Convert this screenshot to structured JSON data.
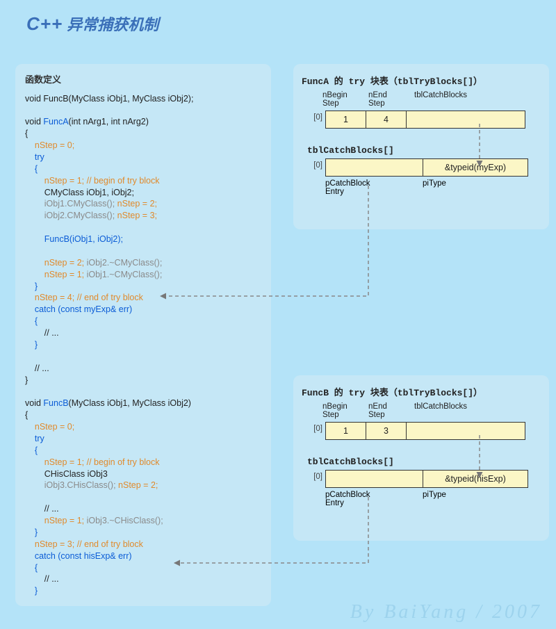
{
  "title": {
    "cpp": "C++",
    "rest": " 异常捕获机制"
  },
  "leftPanel": {
    "heading": "函数定义",
    "lines": [
      {
        "cls": "c-black",
        "text": "void FuncB(MyClass iObj1, MyClass iObj2);"
      },
      {
        "cls": "",
        "text": " "
      },
      {
        "cls": "c-black",
        "html": "void <span class='c-blue'>FuncA</span>(int nArg1, int nArg2)"
      },
      {
        "cls": "c-black",
        "text": "{"
      },
      {
        "cls": "c-orange",
        "text": "    nStep = 0;"
      },
      {
        "cls": "c-blue",
        "text": "    try"
      },
      {
        "cls": "c-blue",
        "text": "    {"
      },
      {
        "cls": "c-orange",
        "html": "        nStep = 1; <span class='c-comment'>// begin of try block</span>"
      },
      {
        "cls": "c-black",
        "text": "        CMyClass iObj1, iObj2;"
      },
      {
        "cls": "c-gray",
        "html": "        iObj1.CMyClass(); <span class='c-orange'>nStep = 2;</span>"
      },
      {
        "cls": "c-gray",
        "html": "        iObj2.CMyClass(); <span class='c-orange'>nStep = 3;</span>"
      },
      {
        "cls": "",
        "text": " "
      },
      {
        "cls": "c-blue",
        "text": "        FuncB(iObj1, iObj2);"
      },
      {
        "cls": "",
        "text": " "
      },
      {
        "cls": "c-orange",
        "html": "        nStep = 2; <span class='c-gray'>iObj2.~CMyClass();</span>"
      },
      {
        "cls": "c-orange",
        "html": "        nStep = 1; <span class='c-gray'>iObj1.~CMyClass();</span>"
      },
      {
        "cls": "c-blue",
        "text": "    }"
      },
      {
        "cls": "c-orange",
        "html": "    nStep = 4; <span class='c-comment'>// end of try block</span>"
      },
      {
        "cls": "c-blue",
        "text": "    catch (const myExp& err)"
      },
      {
        "cls": "c-blue",
        "text": "    {"
      },
      {
        "cls": "c-black",
        "text": "        // ..."
      },
      {
        "cls": "c-blue",
        "text": "    }"
      },
      {
        "cls": "",
        "text": " "
      },
      {
        "cls": "c-black",
        "text": "    // ..."
      },
      {
        "cls": "c-black",
        "text": "}"
      },
      {
        "cls": "",
        "text": " "
      },
      {
        "cls": "c-black",
        "html": "void <span class='c-blue'>FuncB</span>(MyClass iObj1, MyClass iObj2)"
      },
      {
        "cls": "c-black",
        "text": "{"
      },
      {
        "cls": "c-orange",
        "text": "    nStep = 0;"
      },
      {
        "cls": "c-blue",
        "text": "    try"
      },
      {
        "cls": "c-blue",
        "text": "    {"
      },
      {
        "cls": "c-orange",
        "html": "        nStep = 1; <span class='c-comment'>// begin of try block</span>"
      },
      {
        "cls": "c-black",
        "text": "        CHisClass iObj3"
      },
      {
        "cls": "c-gray",
        "html": "        iObj3.CHisClass(); <span class='c-orange'>nStep = 2;</span>"
      },
      {
        "cls": "",
        "text": " "
      },
      {
        "cls": "c-black",
        "text": "        // ..."
      },
      {
        "cls": "c-orange",
        "html": "        nStep = 1; <span class='c-gray'>iObj3.~CHisClass();</span>"
      },
      {
        "cls": "c-blue",
        "text": "    }"
      },
      {
        "cls": "c-orange",
        "html": "    nStep = 3; <span class='c-comment'>// end of try block</span>"
      },
      {
        "cls": "c-blue",
        "text": "    catch (const hisExp& err)"
      },
      {
        "cls": "c-blue",
        "text": "    {"
      },
      {
        "cls": "c-black",
        "text": "        // ..."
      },
      {
        "cls": "c-blue",
        "text": "    }"
      }
    ]
  },
  "tryA": {
    "title": "FuncA 的 try 块表（tblTryBlocks[]）",
    "headers": {
      "h1": "nBegin\nStep",
      "h2": "nEnd\nStep",
      "h3": "tblCatchBlocks"
    },
    "row": {
      "idx": "[0]",
      "c1": "1",
      "c2": "4",
      "c3": ""
    },
    "catchTitle": "tblCatchBlocks[]",
    "catchRow": {
      "idx": "[0]",
      "c1": "",
      "c2": "&typeid(myExp)"
    },
    "botLabels": {
      "l1": "pCatchBlock\nEntry",
      "l2": "piType"
    }
  },
  "tryB": {
    "title": "FuncB 的 try 块表（tblTryBlocks[]）",
    "headers": {
      "h1": "nBegin\nStep",
      "h2": "nEnd\nStep",
      "h3": "tblCatchBlocks"
    },
    "row": {
      "idx": "[0]",
      "c1": "1",
      "c2": "3",
      "c3": ""
    },
    "catchTitle": "tblCatchBlocks[]",
    "catchRow": {
      "idx": "[0]",
      "c1": "",
      "c2": "&typeid(hisExp)"
    },
    "botLabels": {
      "l1": "pCatchBlock\nEntry",
      "l2": "piType"
    }
  },
  "footer": "By BaiYang / 2007"
}
